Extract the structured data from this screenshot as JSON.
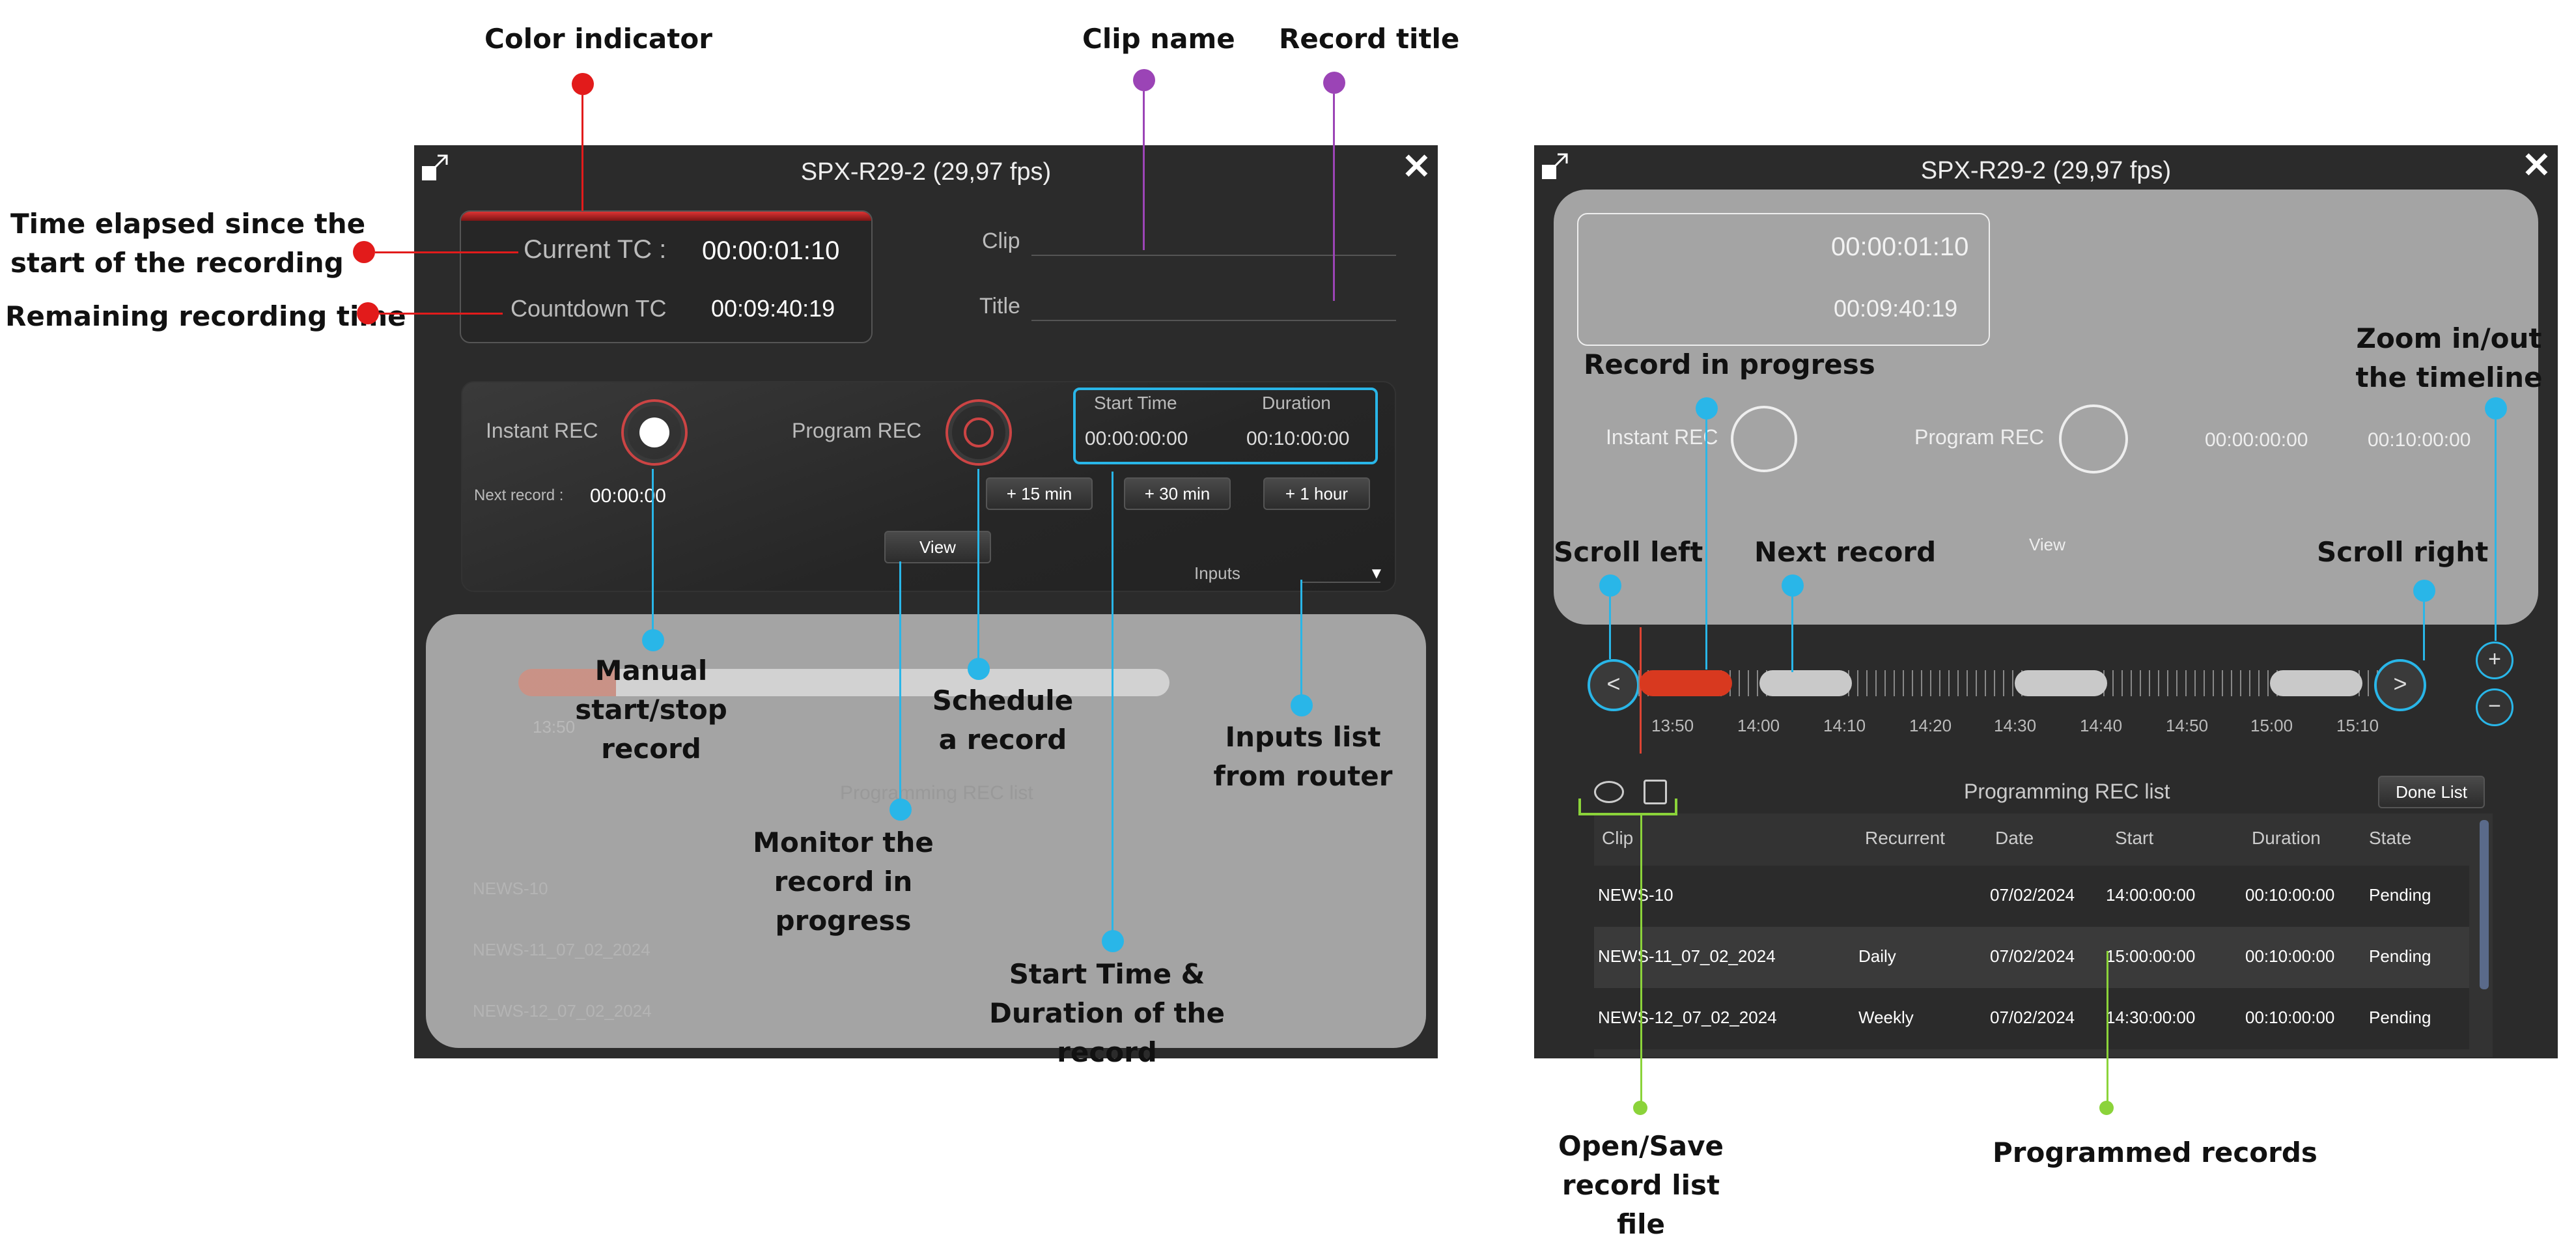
{
  "colors": {
    "annotation_red": "#e21b1b",
    "annotation_purple": "#9b44b6",
    "annotation_cyan": "#29b6e8",
    "annotation_green": "#8bd33a",
    "window_bg": "#2b2b2b",
    "overlay": "#d2d2d2"
  },
  "annotations": {
    "color_indicator": "Color indicator",
    "clip_name": "Clip name",
    "record_title": "Record title",
    "time_elapsed": "Time elapsed since the start of the recording",
    "remaining": "Remaining recording time",
    "manual": "Manual start/stop record",
    "schedule": "Schedule a record",
    "inputs_list": "Inputs list from router",
    "monitor": "Monitor the record in progress",
    "start_duration": "Start Time & Duration of the record",
    "record_in_progress": "Record in progress",
    "zoom": "Zoom in/out the timeline",
    "scroll_left": "Scroll left",
    "next_record": "Next record",
    "scroll_right": "Scroll right",
    "open_save": "Open/Save record list file",
    "programmed_records": "Programmed records"
  },
  "window": {
    "title": "SPX-R29-2 (29,97 fps)",
    "current_tc_label": "Current TC :",
    "current_tc_value": "00:00:01:10",
    "countdown_tc_label": "Countdown TC",
    "countdown_tc_value": "00:09:40:19",
    "clip_label": "Clip",
    "title_label": "Title",
    "instant_rec": "Instant REC",
    "program_rec": "Program REC",
    "start_time_label": "Start Time",
    "start_time_value": "00:00:00:00",
    "duration_label": "Duration",
    "duration_value": "00:10:00:00",
    "next_record_label": "Next record :",
    "next_record_value": "00:00:00",
    "btn_15": "+ 15 min",
    "btn_30": "+ 30 min",
    "btn_1h": "+ 1 hour",
    "view": "View",
    "inputs": "Inputs",
    "close_icon": "close-icon",
    "expand_icon": "expand-icon"
  },
  "timeline": {
    "labels": [
      "13:50",
      "14:00",
      "14:10",
      "14:20",
      "14:30",
      "14:40",
      "14:50",
      "15:00",
      "15:10"
    ],
    "zoom_in": "+",
    "zoom_out": "−"
  },
  "rec_list": {
    "title": "Programming REC list",
    "done_list": "Done List",
    "columns": [
      "Clip",
      "Recurrent",
      "Date",
      "Start",
      "Duration",
      "State"
    ],
    "rows": [
      [
        "NEWS-10",
        "",
        "07/02/2024",
        "14:00:00:00",
        "00:10:00:00",
        "Pending"
      ],
      [
        "NEWS-11_07_02_2024",
        "Daily",
        "07/02/2024",
        "15:00:00:00",
        "00:10:00:00",
        "Pending"
      ],
      [
        "NEWS-12_07_02_2024",
        "Weekly",
        "07/02/2024",
        "14:30:00:00",
        "00:10:00:00",
        "Pending"
      ]
    ]
  }
}
